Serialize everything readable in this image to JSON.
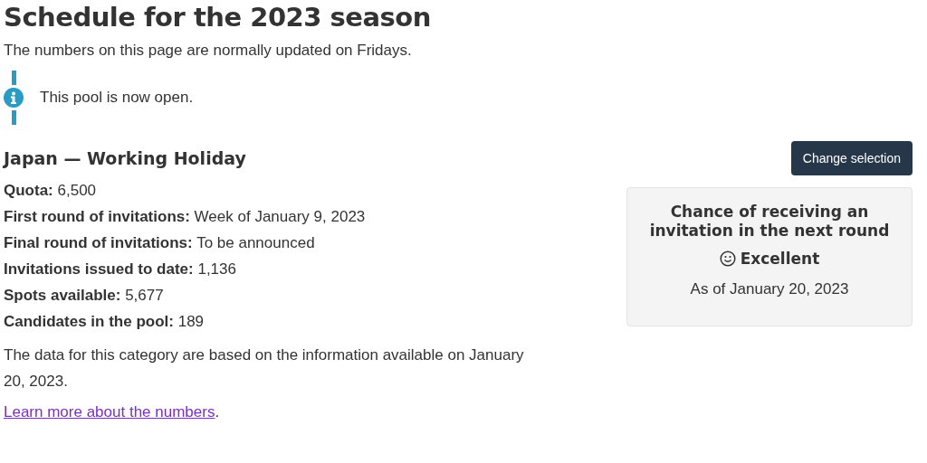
{
  "title": "Schedule for the 2023 season",
  "intro": "The numbers on this page are normally updated on Fridays.",
  "notice": {
    "text": "This pool is now open."
  },
  "category": {
    "title": "Japan — Working Holiday",
    "button": "Change selection"
  },
  "facts": [
    "**Quota:** 6,500",
    "**First round of invitations:** Week of January 9, 2023",
    "**Final round of invitations:** To be announced",
    "**Invitations issued to date:** 1,136",
    "**Spots available:** 5,677",
    "**Candidates in the pool:** 189"
  ],
  "note": "The data for this category are based on the information available on January 20, 2023.",
  "link": {
    "text": "Learn more about the numbers",
    "after": "."
  },
  "chance": {
    "heading": "Chance of receiving an invitation in the next round",
    "rating": "Excellent",
    "date": "As of January 20, 2023"
  }
}
